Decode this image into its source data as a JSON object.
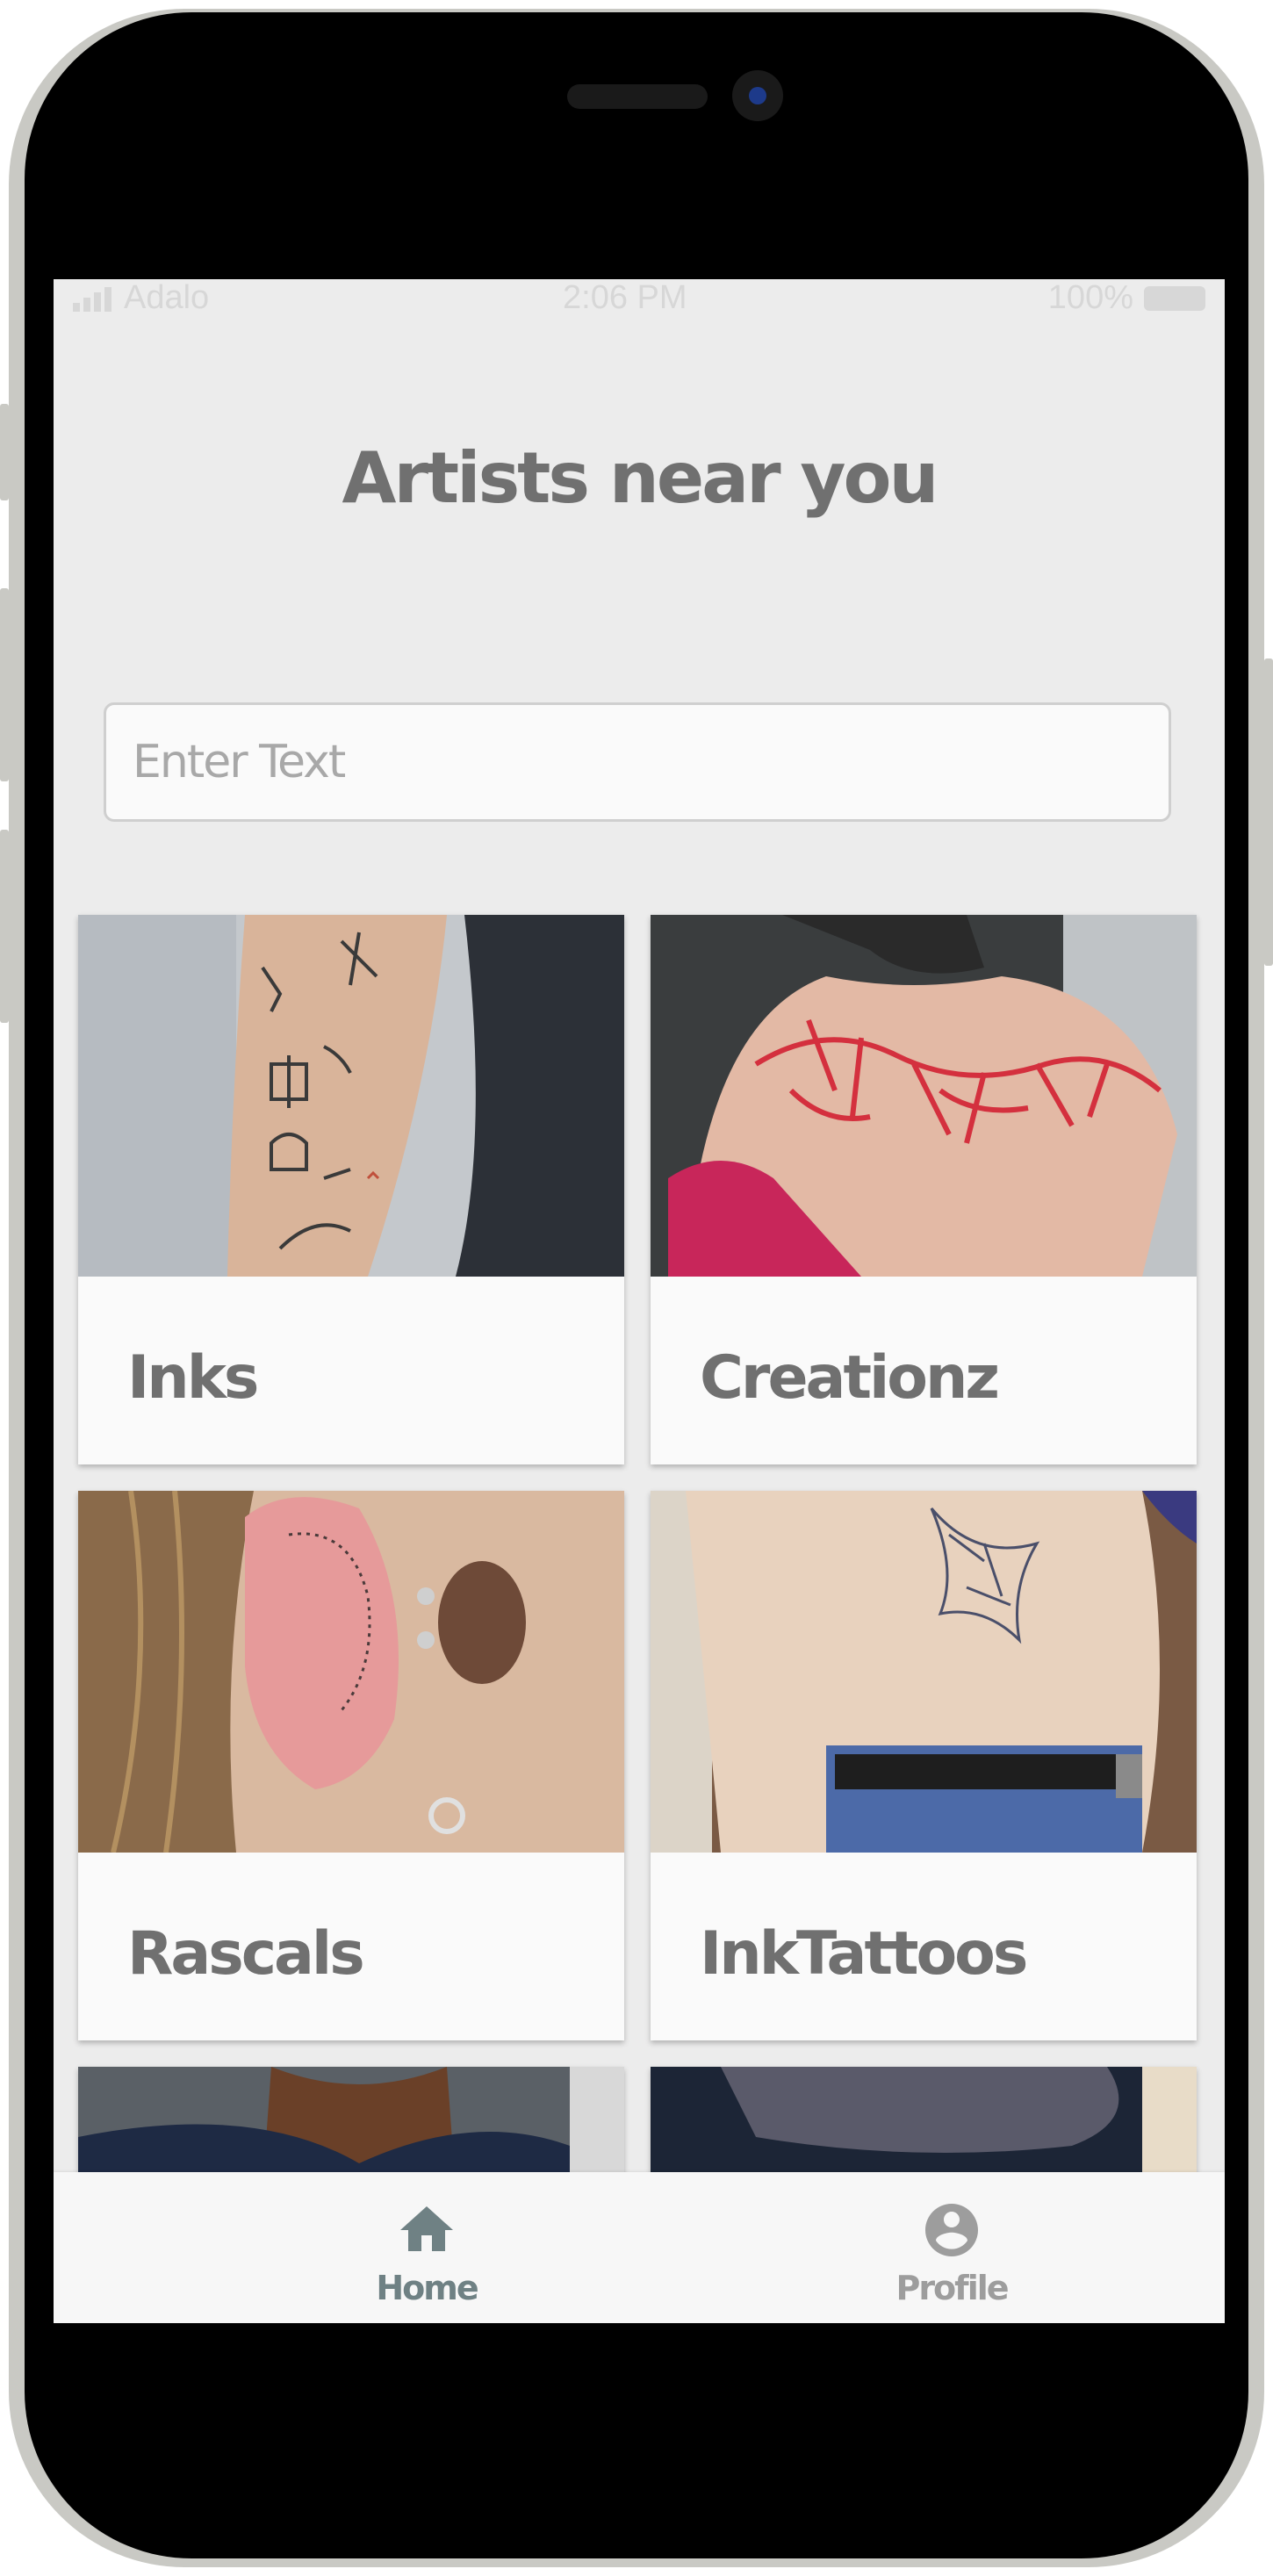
{
  "status_bar": {
    "carrier": "Adalo",
    "time": "2:06 PM",
    "battery": "100%"
  },
  "header": {
    "title": "Artists near you"
  },
  "search": {
    "placeholder": "Enter Text",
    "value": ""
  },
  "artists": [
    {
      "name": "Inks"
    },
    {
      "name": "Creationz"
    },
    {
      "name": "Rascals"
    },
    {
      "name": "InkTattoos"
    }
  ],
  "tab_bar": {
    "tabs": [
      {
        "label": "Home",
        "icon": "home-icon",
        "active": true
      },
      {
        "label": "Profile",
        "icon": "account-circle-icon",
        "active": false
      }
    ]
  },
  "colors": {
    "screen_background": "#ececec",
    "title_text": "#707070",
    "card_background": "#fafafa",
    "active_tab": "#6f8184",
    "inactive_tab": "#9d9d9d"
  }
}
